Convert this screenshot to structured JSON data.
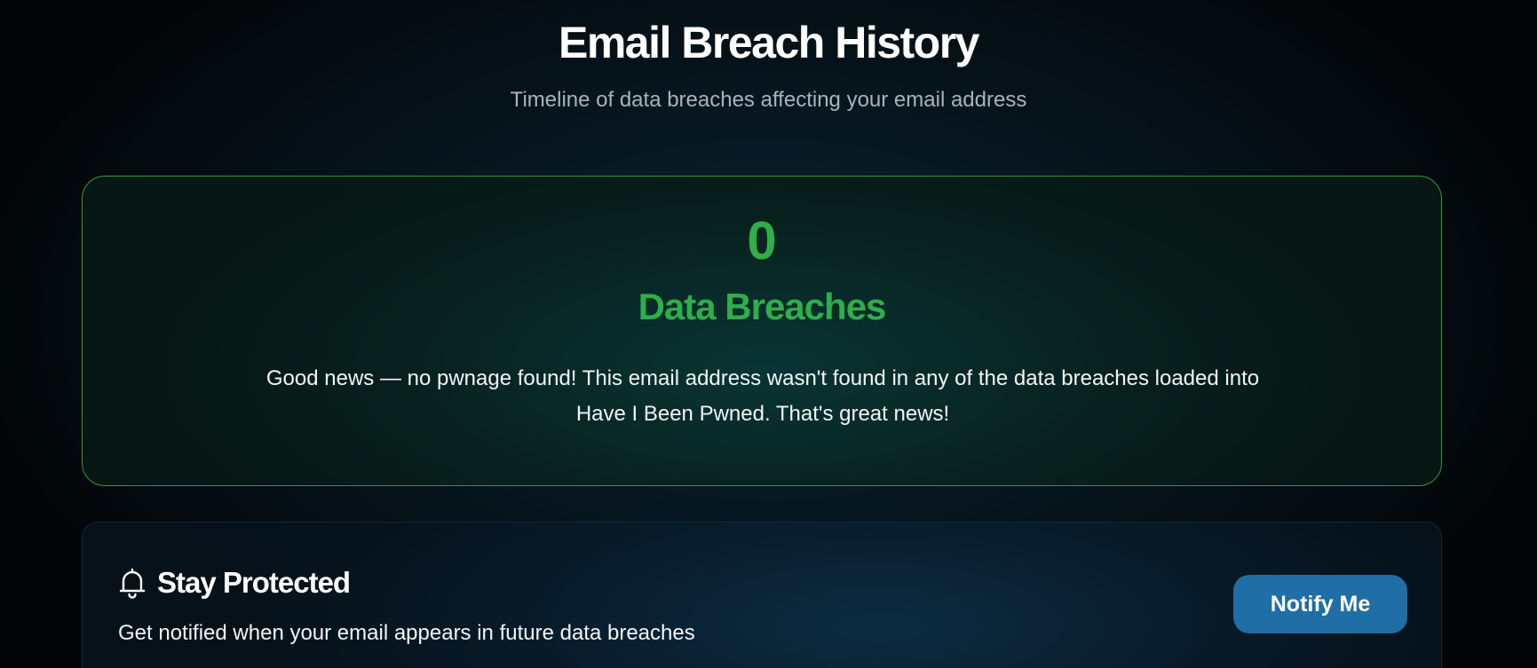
{
  "header": {
    "title": "Email Breach History",
    "subtitle": "Timeline of data breaches affecting your email address"
  },
  "result": {
    "count": "0",
    "label": "Data Breaches",
    "message": "Good news — no pwnage found! This email address wasn't found in any of the data breaches loaded into Have I Been Pwned. That's great news!"
  },
  "protect": {
    "icon": "bell-icon",
    "title": "Stay Protected",
    "description": "Get notified when your email appears in future data breaches",
    "button_label": "Notify Me"
  },
  "colors": {
    "accent_green": "#2fae4a",
    "card_border_green": "#2f9a3a",
    "button_blue": "#1f6ea6",
    "subtitle_gray": "#a9b3bb"
  }
}
